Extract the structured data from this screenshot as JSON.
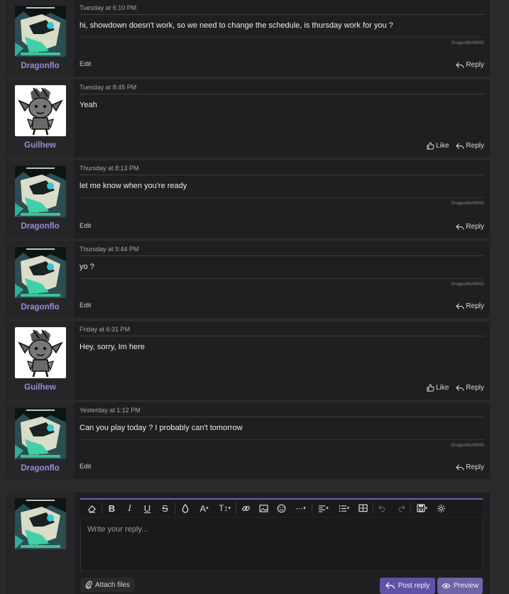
{
  "messages": [
    {
      "user": "Dragonflo",
      "avatar": "dragonflo",
      "date": "Tuesday at 6:10 PM",
      "text": "hi, showdown doesn't work, so we need to change the schedule, is thursday work for you ?",
      "signature": "Dragonflo#9591",
      "edit": "Edit",
      "like": null,
      "reply": "Reply"
    },
    {
      "user": "Guilhew",
      "avatar": "guilhew",
      "date": "Tuesday at 8:45 PM",
      "text": "Yeah",
      "signature": null,
      "edit": null,
      "like": "Like",
      "reply": "Reply"
    },
    {
      "user": "Dragonflo",
      "avatar": "dragonflo",
      "date": "Thursday at 8:13 PM",
      "text": "let me know when you're ready",
      "signature": "Dragonflo#9591",
      "edit": "Edit",
      "like": null,
      "reply": "Reply"
    },
    {
      "user": "Dragonflo",
      "avatar": "dragonflo",
      "date": "Thursday at 9:44 PM",
      "text": "yo ?",
      "signature": "Dragonflo#9591",
      "edit": "Edit",
      "like": null,
      "reply": "Reply"
    },
    {
      "user": "Guilhew",
      "avatar": "guilhew",
      "date": "Friday at 6:31 PM",
      "text": "Hey, sorry, Im here",
      "signature": null,
      "edit": null,
      "like": "Like",
      "reply": "Reply"
    },
    {
      "user": "Dragonflo",
      "avatar": "dragonflo",
      "date": "Yesterday at 1:12 PM",
      "text": "Can you play today ? I probably can't tomorrow",
      "signature": "Dragonflo#9591",
      "edit": "Edit",
      "like": null,
      "reply": "Reply"
    }
  ],
  "reply_box": {
    "placeholder": "Write your reply...",
    "attach_label": "Attach files",
    "post_label": "Post reply",
    "preview_label": "Preview",
    "toolbar_icons": [
      "eraser-icon",
      "bold-icon",
      "italic-icon",
      "underline-icon",
      "strikethrough-icon",
      "text-color-icon",
      "font-family-icon",
      "font-size-icon",
      "link-icon",
      "image-icon",
      "smilie-icon",
      "more-icon",
      "align-icon",
      "list-icon",
      "table-icon",
      "undo-icon",
      "redo-icon",
      "drafts-icon",
      "settings-icon"
    ]
  },
  "colors": {
    "accent": "#6f5fb0",
    "username": "#9c8ad8",
    "background": "#2a2a2c",
    "panel": "#1f1f21"
  }
}
